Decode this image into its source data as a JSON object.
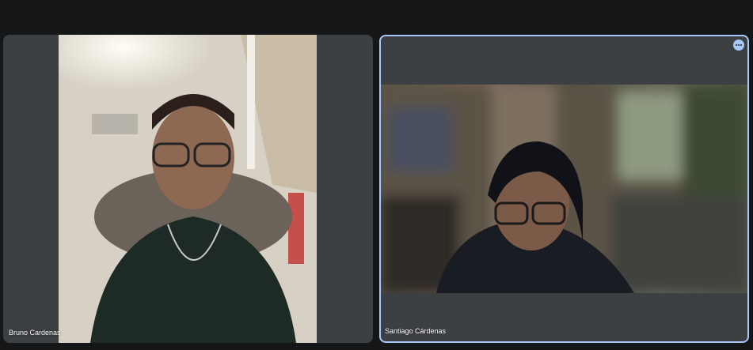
{
  "participants": [
    {
      "name": "Bruno Cardenas",
      "active_speaker": false
    },
    {
      "name": "Santiago Cárdenas",
      "active_speaker": true
    }
  ],
  "colors": {
    "background": "#151617",
    "tile": "#3c4043",
    "active_border": "#a8c7fa",
    "label_text": "#ffffff"
  },
  "icons": {
    "more_options": "more-horizontal-icon"
  }
}
